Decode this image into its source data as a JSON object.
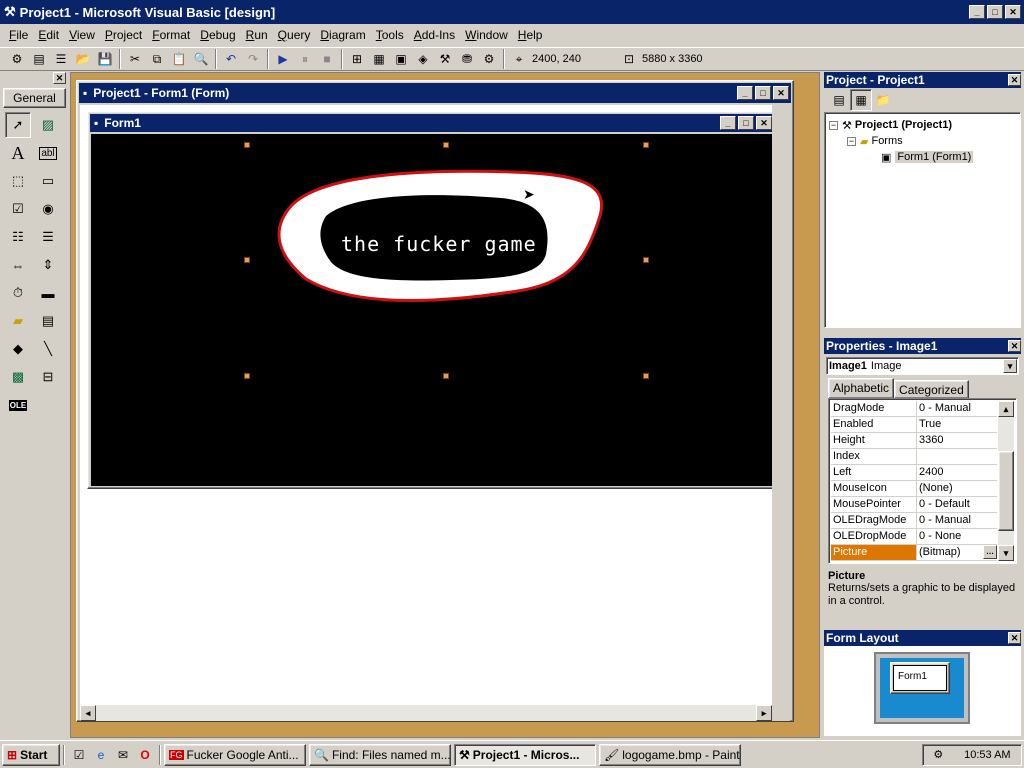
{
  "app": {
    "title": "Project1 - Microsoft Visual Basic [design]"
  },
  "menu": [
    "File",
    "Edit",
    "View",
    "Project",
    "Format",
    "Debug",
    "Run",
    "Query",
    "Diagram",
    "Tools",
    "Add-Ins",
    "Window",
    "Help"
  ],
  "toolbar": {
    "position": "2400, 240",
    "size": "5880 x 3360"
  },
  "toolbox": {
    "tab": "General"
  },
  "designer": {
    "title": "Project1 - Form1 (Form)",
    "form_title": "Form1",
    "image_text": "the fucker game"
  },
  "project": {
    "title": "Project - Project1",
    "root": "Project1 (Project1)",
    "folder": "Forms",
    "item": "Form1 (Form1)"
  },
  "properties": {
    "title": "Properties - Image1",
    "object_name": "Image1",
    "object_type": "Image",
    "tab_alpha": "Alphabetic",
    "tab_cat": "Categorized",
    "rows": [
      {
        "name": "DragMode",
        "value": "0 - Manual"
      },
      {
        "name": "Enabled",
        "value": "True"
      },
      {
        "name": "Height",
        "value": "3360"
      },
      {
        "name": "Index",
        "value": ""
      },
      {
        "name": "Left",
        "value": "2400"
      },
      {
        "name": "MouseIcon",
        "value": "(None)"
      },
      {
        "name": "MousePointer",
        "value": "0 - Default"
      },
      {
        "name": "OLEDragMode",
        "value": "0 - Manual"
      },
      {
        "name": "OLEDropMode",
        "value": "0 - None"
      },
      {
        "name": "Picture",
        "value": "(Bitmap)"
      }
    ],
    "desc_title": "Picture",
    "desc_text": "Returns/sets a graphic to be displayed in a control."
  },
  "form_layout": {
    "title": "Form Layout",
    "preview": "Form1"
  },
  "taskbar": {
    "start": "Start",
    "items": [
      "Fucker Google Anti...",
      "Find: Files named m...",
      "Project1 - Micros...",
      "logogame.bmp - Paint"
    ],
    "clock": "10:53 AM"
  }
}
